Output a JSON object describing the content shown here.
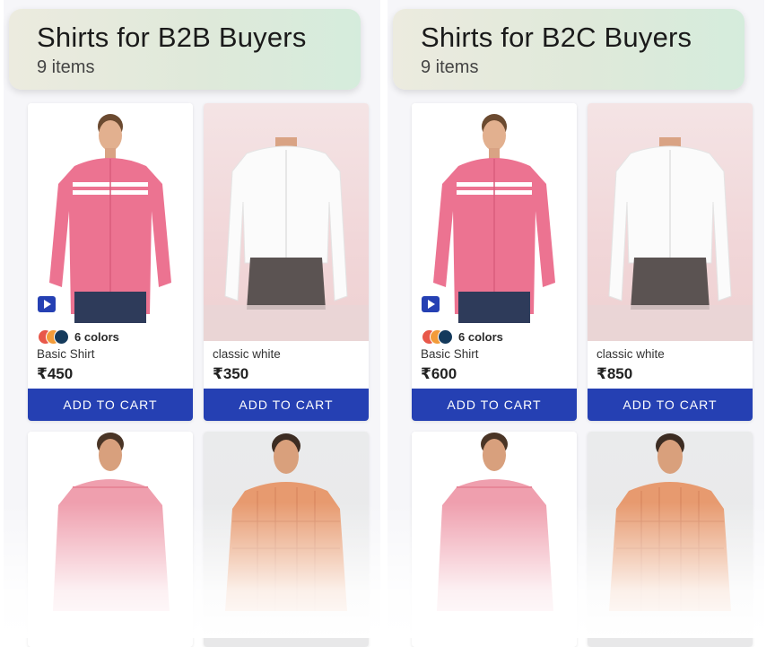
{
  "panels": [
    {
      "title": "Shirts for B2B Buyers",
      "count": "9 items",
      "products": [
        {
          "name": "Basic Shirt",
          "price": "₹450",
          "colors": "6 colors",
          "button": "ADD TO CART",
          "image": "pink-striped-shirt-model"
        },
        {
          "name": "classic white",
          "price": "₹350",
          "button": "ADD TO CART",
          "image": "white-shirt-model"
        },
        {
          "image": "pink-check-shirt-model"
        },
        {
          "image": "orange-check-shirt-model"
        }
      ]
    },
    {
      "title": "Shirts for B2C Buyers",
      "count": "9 items",
      "products": [
        {
          "name": "Basic Shirt",
          "price": "₹600",
          "colors": "6 colors",
          "button": "ADD TO CART",
          "image": "pink-striped-shirt-model"
        },
        {
          "name": "classic white",
          "price": "₹850",
          "button": "ADD TO CART",
          "image": "white-shirt-model"
        },
        {
          "image": "pink-check-shirt-model"
        },
        {
          "image": "orange-check-shirt-model"
        }
      ]
    }
  ],
  "swatch_colors": [
    "#e8584a",
    "#f29b3a",
    "#143a5c"
  ],
  "icons": {
    "video": "play-video-icon"
  },
  "colors": {
    "accent": "#2540b3"
  }
}
